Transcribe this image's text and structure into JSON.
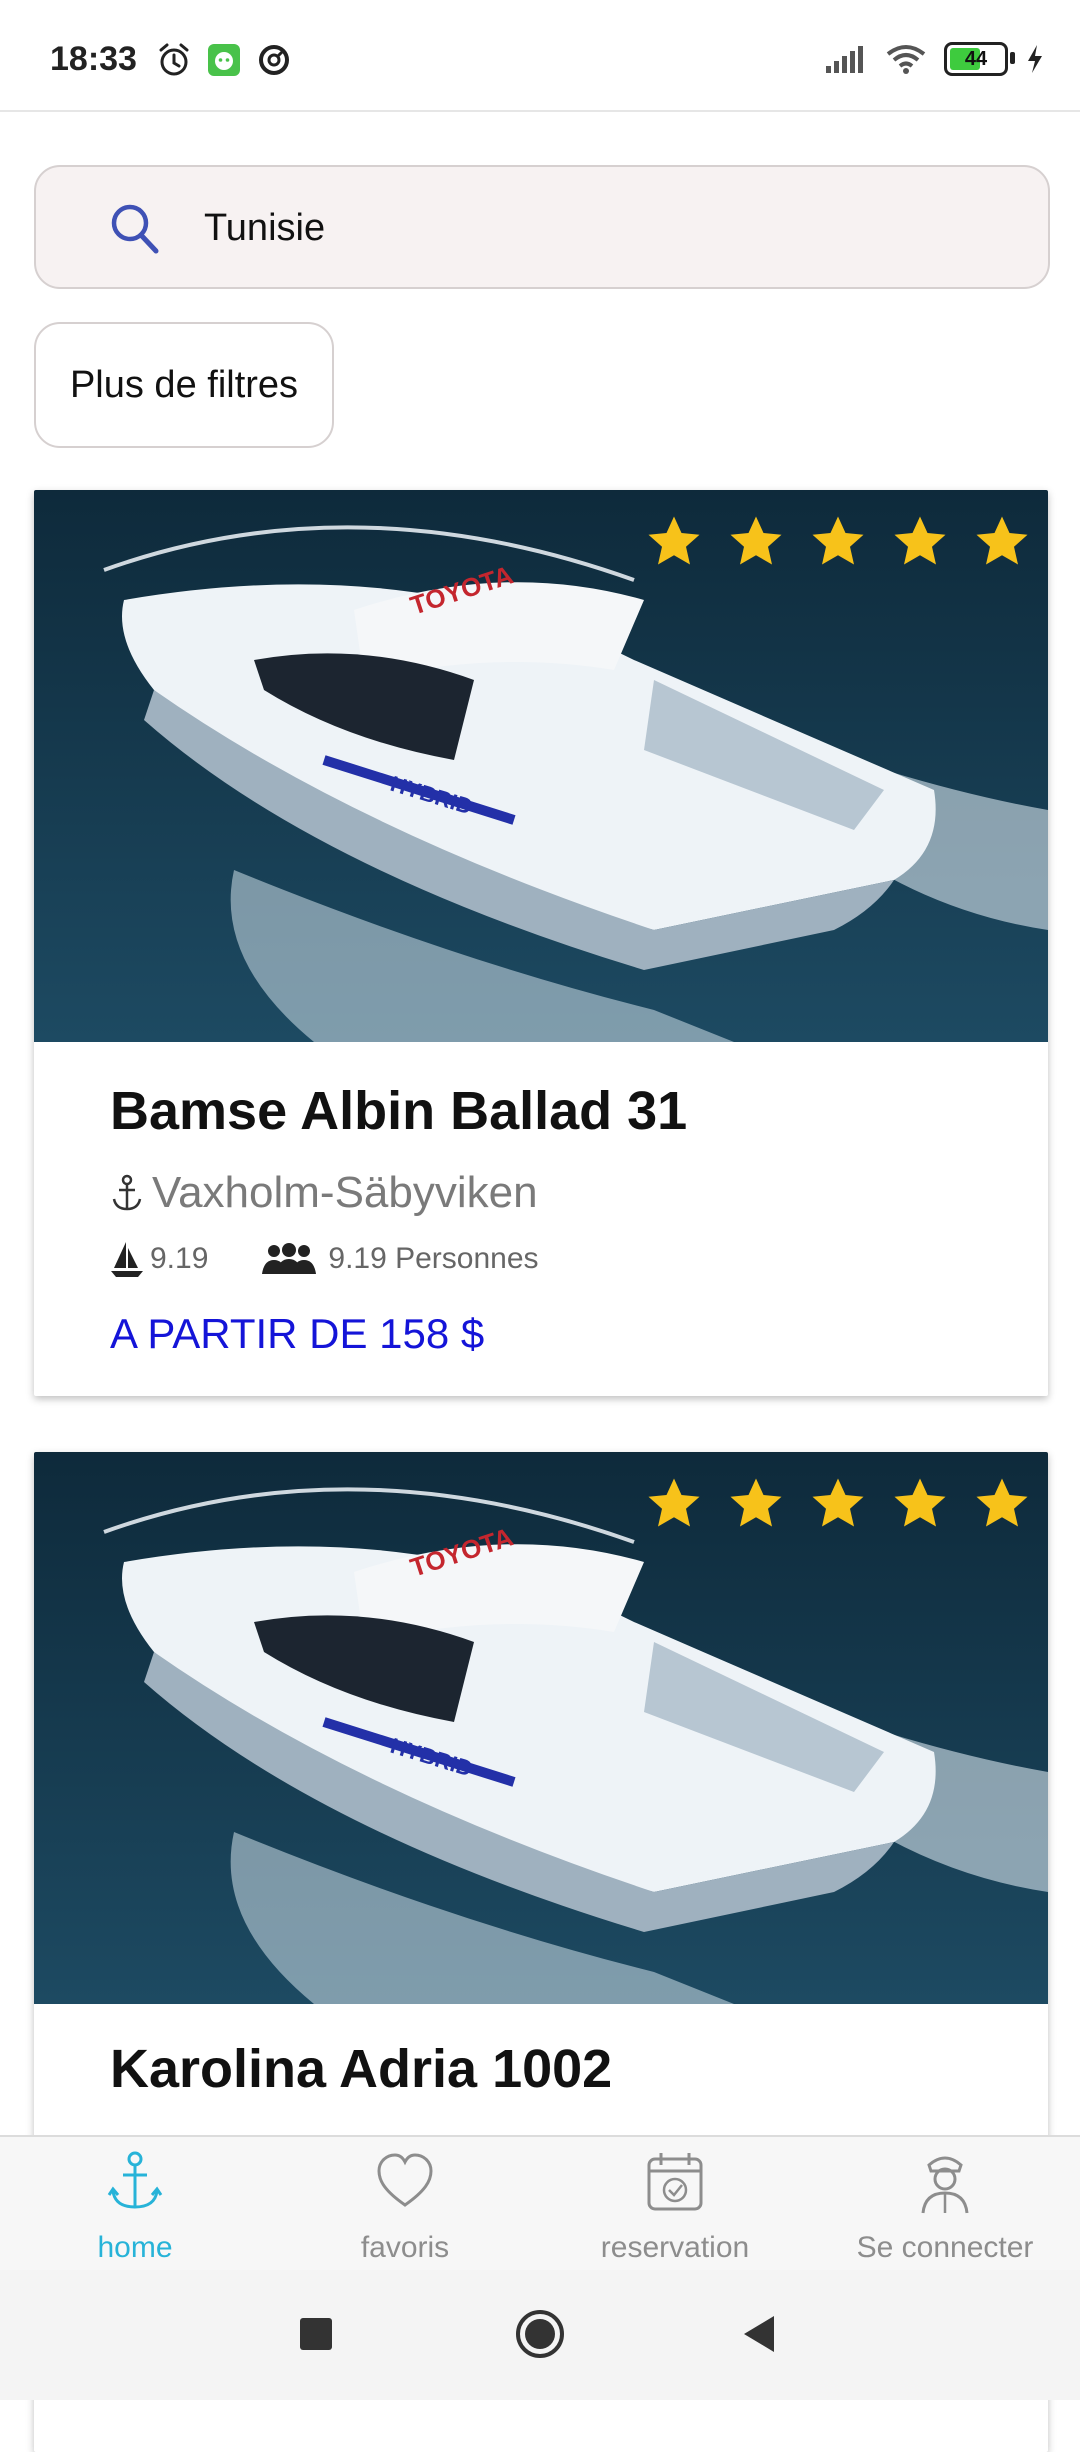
{
  "status_bar": {
    "time": "18:33",
    "battery": "44"
  },
  "search": {
    "value": "Tunisie",
    "placeholder": ""
  },
  "filters": {
    "label": "Plus de filtres"
  },
  "listings": [
    {
      "title": "Bamse Albin Ballad 31",
      "location": "Vaxholm-Säbyviken",
      "length": "9.19",
      "capacity": "9.19 Personnes",
      "price": "A PARTIR DE 158 $",
      "rating": 5,
      "boat_text": [
        "TOYOTA",
        "HYBRID"
      ]
    },
    {
      "title": "Karolina Adria 1002",
      "rating": 5,
      "boat_text": [
        "TOYOTA",
        "HYBRID"
      ]
    }
  ],
  "bottom_nav": [
    {
      "label": "home",
      "icon": "anchor-icon",
      "active": true
    },
    {
      "label": "favoris",
      "icon": "heart-icon",
      "active": false
    },
    {
      "label": "reservation",
      "icon": "calendar-check-icon",
      "active": false
    },
    {
      "label": "Se connecter",
      "icon": "captain-icon",
      "active": false
    }
  ],
  "colors": {
    "accent": "#27b3d8",
    "price": "#1414d8",
    "star": "#f7c21a",
    "water": "#123447"
  }
}
